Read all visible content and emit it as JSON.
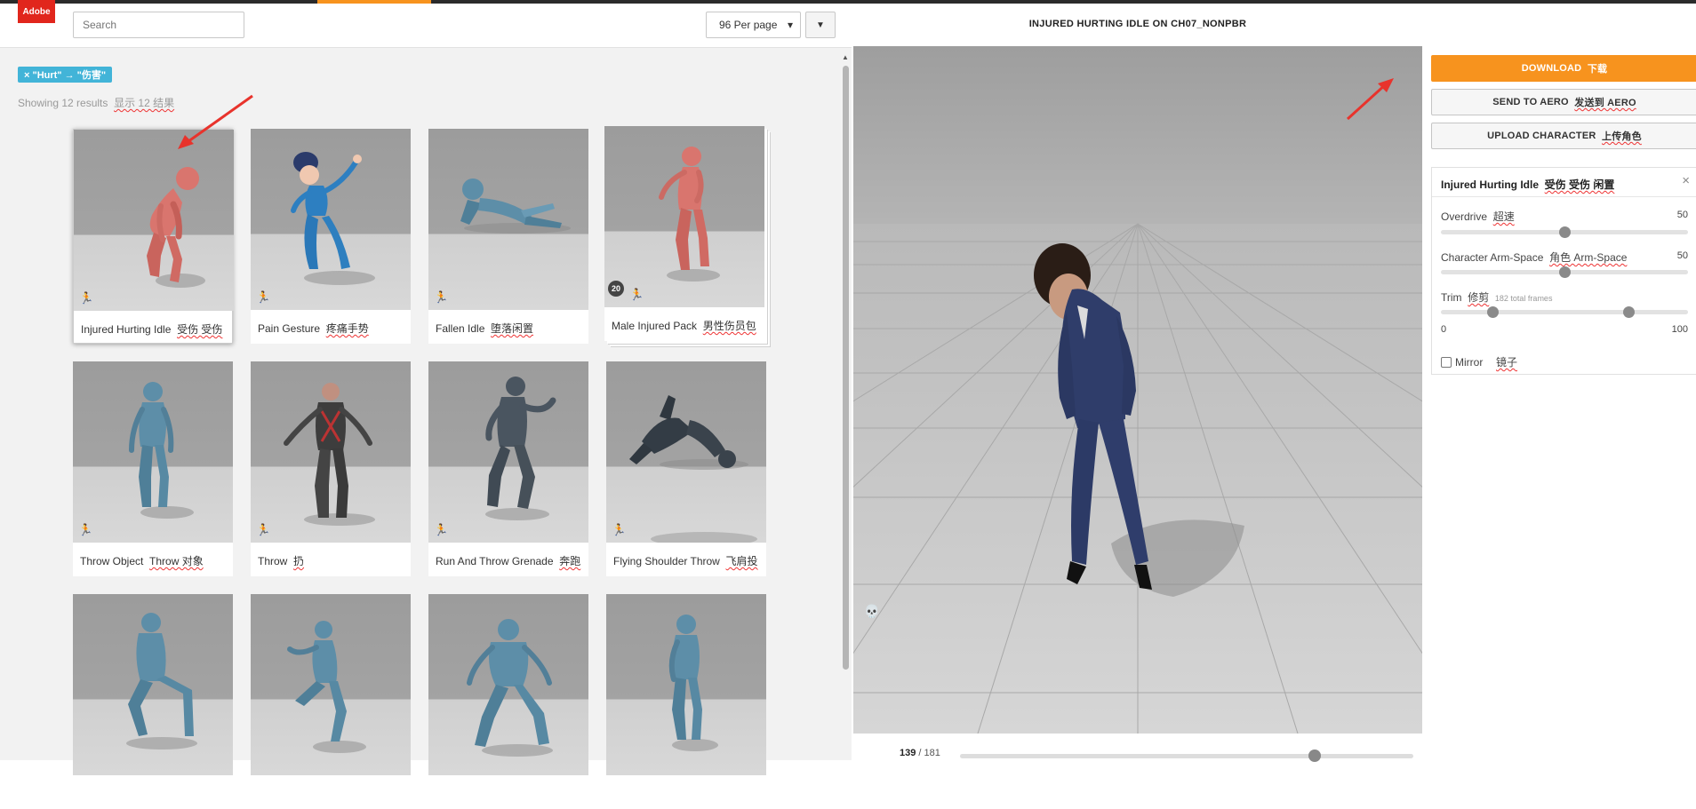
{
  "app": {
    "logo_text": "Adobe"
  },
  "header": {
    "search_placeholder": "Search",
    "per_page": "96 Per page",
    "per_page_caret": "▾"
  },
  "filter": {
    "tag": "× \"Hurt\" → \"伤害\"",
    "results_prefix": "Showing 12 results",
    "results_cn": "显示 12 结果"
  },
  "cards": [
    {
      "en": "Injured Hurting Idle",
      "cn": "受伤 受伤"
    },
    {
      "en": "Pain Gesture",
      "cn": "疼痛手势"
    },
    {
      "en": "Fallen Idle",
      "cn": "堕落闲置"
    },
    {
      "en": "Male Injured Pack",
      "cn": "男性伤员包",
      "count": "20"
    },
    {
      "en": "Throw Object",
      "cn": "Throw 对象"
    },
    {
      "en": "Throw",
      "cn": "扔"
    },
    {
      "en": "Run And Throw Grenade",
      "cn": "奔跑"
    },
    {
      "en": "Flying Shoulder Throw",
      "cn": "飞肩投"
    },
    {
      "en": "",
      "cn": ""
    },
    {
      "en": "",
      "cn": ""
    },
    {
      "en": "",
      "cn": ""
    },
    {
      "en": "",
      "cn": ""
    }
  ],
  "viewer": {
    "title": "INJURED HURTING IDLE ON CH07_NONPBR",
    "frame_current": "139",
    "frame_total": "/ 181",
    "frame_progress": 0.768
  },
  "actions": {
    "download": "DOWNLOAD",
    "download_cn": "下载",
    "send_aero": "SEND TO AERO",
    "send_aero_cn": "发送到 AERO",
    "upload": "UPLOAD CHARACTER",
    "upload_cn": "上传角色"
  },
  "settings": {
    "title_en": "Injured Hurting Idle",
    "title_cn": "受伤 受伤 闲置",
    "close": "×",
    "overdrive_label": "Overdrive",
    "overdrive_cn": "超速",
    "overdrive_value": "50",
    "armspace_label": "Character Arm-Space",
    "armspace_cn": "角色 Arm-Space",
    "armspace_value": "50",
    "trim_label": "Trim",
    "trim_cn": "修剪",
    "trim_note": "182 total frames",
    "trim_min": "0",
    "trim_max": "100",
    "trim_start_fraction": 0.21,
    "trim_end_fraction": 0.76,
    "mirror_label": "Mirror",
    "mirror_cn": "镜子"
  },
  "colors": {
    "accent": "#f7931e",
    "brand_red": "#e1261c",
    "tag_blue": "#42b4d8",
    "mannequin_red": "#d9756e",
    "mannequin_blue": "#5d8ea8"
  }
}
